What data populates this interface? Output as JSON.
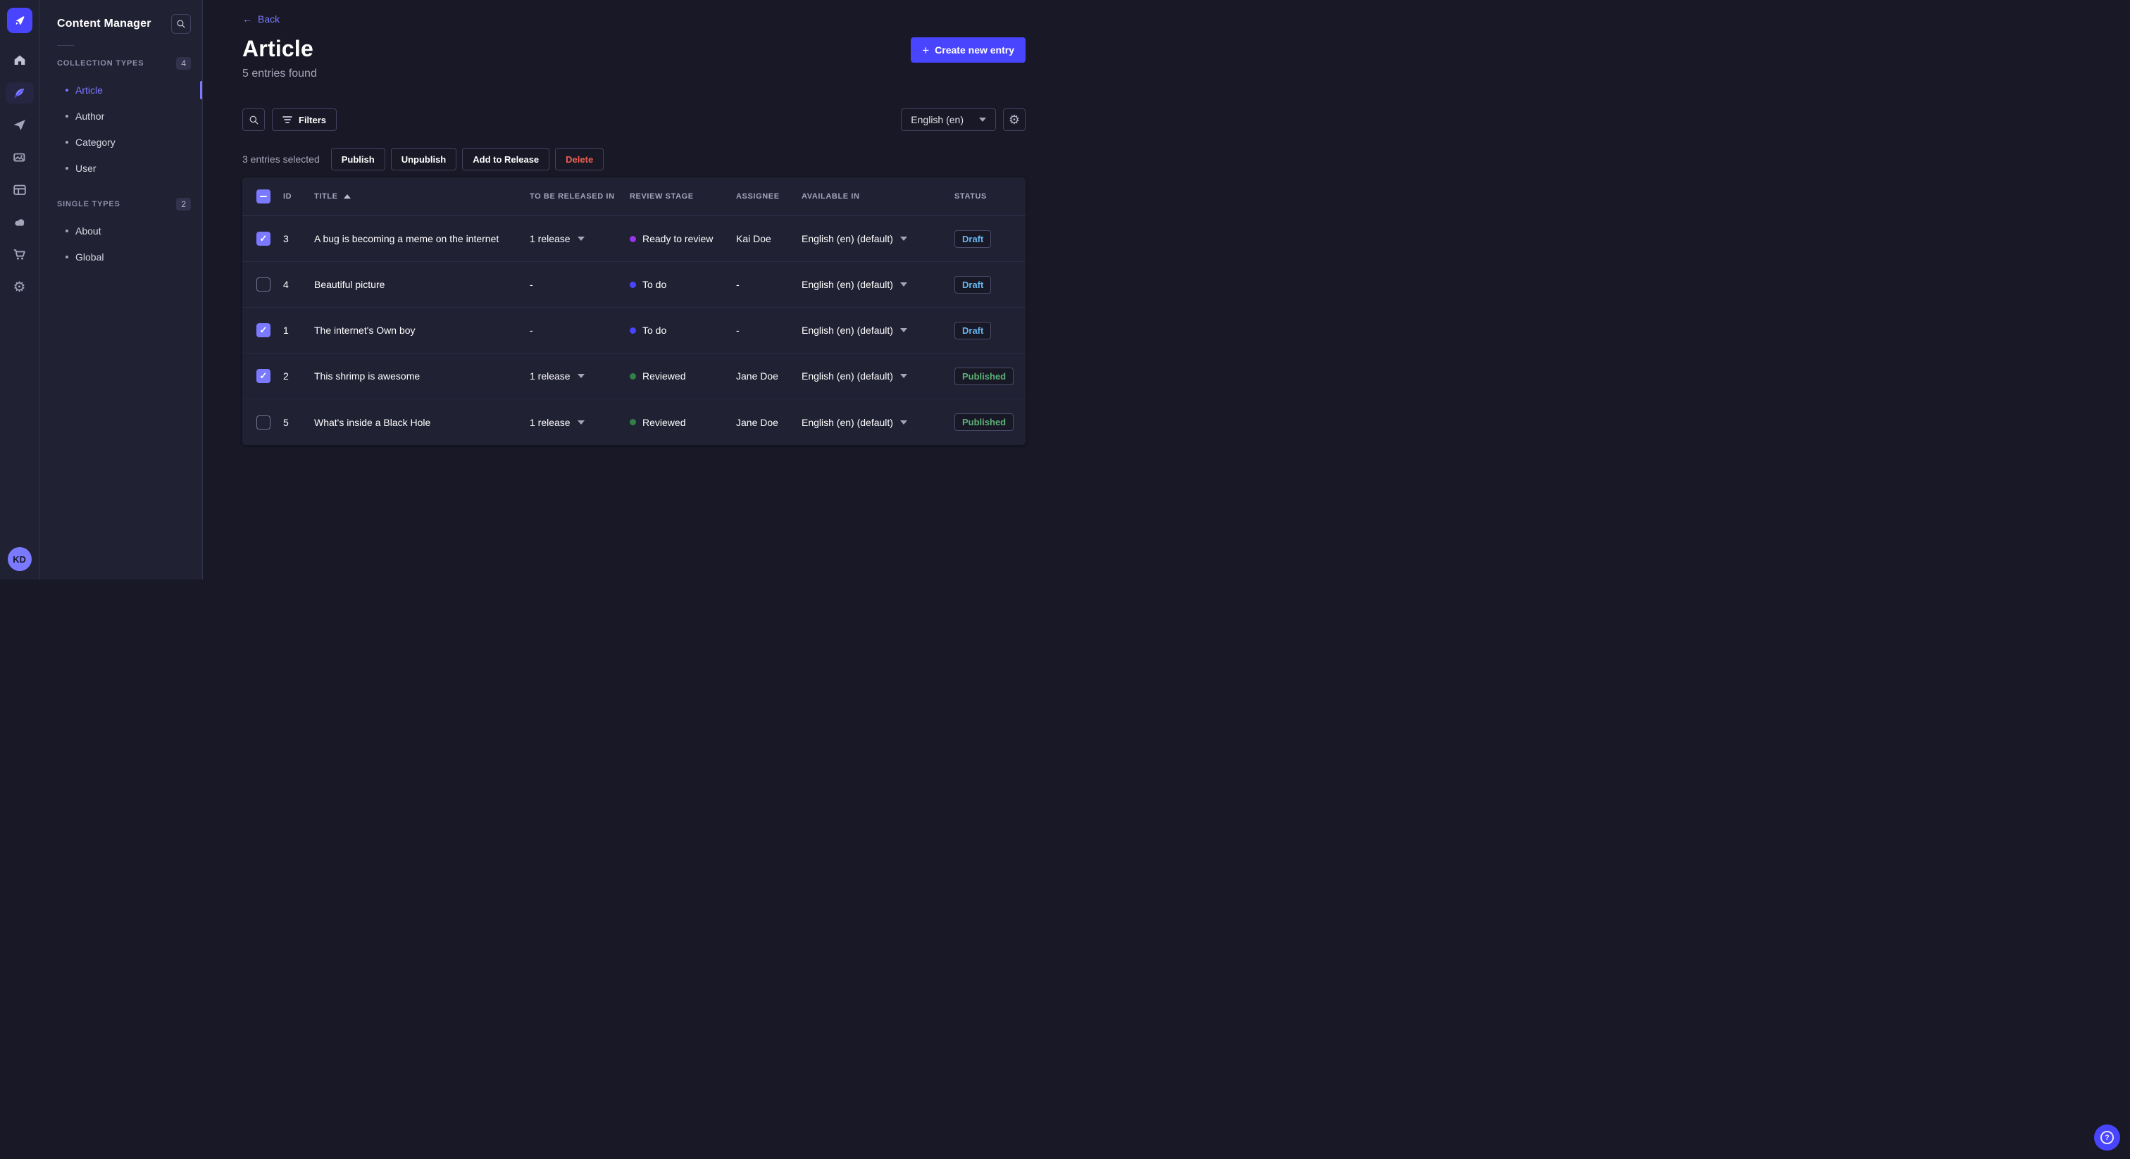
{
  "rail": {
    "icons": [
      "strapi-logo",
      "home-icon",
      "content-manager-icon",
      "releases-icon",
      "media-library-icon",
      "content-type-builder-icon",
      "deploy-icon",
      "marketplace-icon",
      "settings-icon"
    ],
    "avatar_initials": "KD"
  },
  "sidebar": {
    "title": "Content Manager",
    "sections": [
      {
        "label": "COLLECTION TYPES",
        "count": "4",
        "items": [
          {
            "label": "Article",
            "active": true
          },
          {
            "label": "Author",
            "active": false
          },
          {
            "label": "Category",
            "active": false
          },
          {
            "label": "User",
            "active": false
          }
        ]
      },
      {
        "label": "SINGLE TYPES",
        "count": "2",
        "items": [
          {
            "label": "About",
            "active": false
          },
          {
            "label": "Global",
            "active": false
          }
        ]
      }
    ]
  },
  "header": {
    "back_label": "Back",
    "title": "Article",
    "subtitle": "5 entries found",
    "create_button": "Create new entry"
  },
  "toolbar": {
    "filters_label": "Filters",
    "locale": "English (en)"
  },
  "selection": {
    "text": "3 entries selected",
    "publish": "Publish",
    "unpublish": "Unpublish",
    "add_to_release": "Add to Release",
    "delete": "Delete"
  },
  "table": {
    "columns": [
      "ID",
      "TITLE",
      "TO BE RELEASED IN",
      "REVIEW STAGE",
      "ASSIGNEE",
      "AVAILABLE IN",
      "STATUS"
    ],
    "rows": [
      {
        "checked": true,
        "id": "3",
        "title": "A bug is becoming a meme on the internet",
        "release": "1 release",
        "stage": "Ready to review",
        "stage_color": "#9736e8",
        "assignee": "Kai Doe",
        "available": "English (en) (default)",
        "status": "Draft",
        "status_color": "#66b7f1"
      },
      {
        "checked": false,
        "id": "4",
        "title": "Beautiful picture",
        "release": "-",
        "stage": "To do",
        "stage_color": "#4945ff",
        "assignee": "-",
        "available": "English (en) (default)",
        "status": "Draft",
        "status_color": "#66b7f1"
      },
      {
        "checked": true,
        "id": "1",
        "title": "The internet's Own boy",
        "release": "-",
        "stage": "To do",
        "stage_color": "#4945ff",
        "assignee": "-",
        "available": "English (en) (default)",
        "status": "Draft",
        "status_color": "#66b7f1"
      },
      {
        "checked": true,
        "id": "2",
        "title": "This shrimp is awesome",
        "release": "1 release",
        "stage": "Reviewed",
        "stage_color": "#328048",
        "assignee": "Jane Doe",
        "available": "English (en) (default)",
        "status": "Published",
        "status_color": "#5cb176"
      },
      {
        "checked": false,
        "id": "5",
        "title": "What's inside a Black Hole",
        "release": "1 release",
        "stage": "Reviewed",
        "stage_color": "#328048",
        "assignee": "Jane Doe",
        "available": "English (en) (default)",
        "status": "Published",
        "status_color": "#5cb176"
      }
    ]
  },
  "colors": {
    "primary": "#4945ff",
    "primary_light": "#7b79ff",
    "draft": "#66b7f1",
    "published": "#5cb176",
    "danger": "#ee5e52",
    "stage_ready_to_review": "#9736e8",
    "stage_to_do": "#4945ff",
    "stage_reviewed": "#328048"
  }
}
